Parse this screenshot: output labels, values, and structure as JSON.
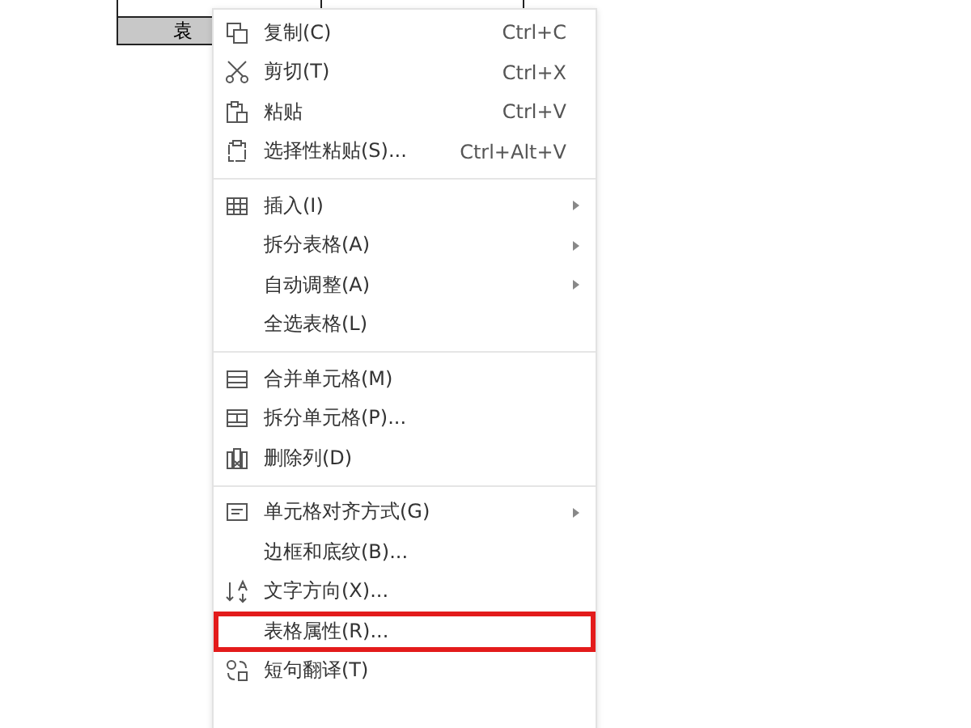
{
  "table": {
    "header_cells": [
      "",
      ""
    ],
    "cell": "袁"
  },
  "context_menu": {
    "groups": [
      [
        {
          "kind": "copy",
          "label": "复制(C)",
          "shortcut": "Ctrl+C",
          "has_submenu": false,
          "highlighted": false
        },
        {
          "kind": "cut",
          "label": "剪切(T)",
          "shortcut": "Ctrl+X",
          "has_submenu": false,
          "highlighted": false
        },
        {
          "kind": "paste",
          "label": "粘贴",
          "shortcut": "Ctrl+V",
          "has_submenu": false,
          "highlighted": false
        },
        {
          "kind": "paste_special",
          "label": "选择性粘贴(S)...",
          "shortcut": "Ctrl+Alt+V",
          "has_submenu": false,
          "highlighted": false
        }
      ],
      [
        {
          "kind": "insert",
          "label": "插入(I)",
          "has_submenu": true,
          "highlighted": false
        },
        {
          "kind": "plain",
          "label": "拆分表格(A)",
          "has_submenu": true,
          "highlighted": false
        },
        {
          "kind": "plain",
          "label": "自动调整(A)",
          "has_submenu": true,
          "highlighted": false
        },
        {
          "kind": "plain",
          "label": "全选表格(L)",
          "has_submenu": false,
          "highlighted": false
        }
      ],
      [
        {
          "kind": "merge",
          "label": "合并单元格(M)",
          "has_submenu": false,
          "highlighted": false
        },
        {
          "kind": "split",
          "label": "拆分单元格(P)...",
          "has_submenu": false,
          "highlighted": false
        },
        {
          "kind": "delete_column",
          "label": "删除列(D)",
          "has_submenu": false,
          "highlighted": false
        }
      ],
      [
        {
          "kind": "align",
          "label": "单元格对齐方式(G)",
          "has_submenu": true,
          "highlighted": false
        },
        {
          "kind": "plain",
          "label": "边框和底纹(B)...",
          "has_submenu": false,
          "highlighted": false
        },
        {
          "kind": "direction",
          "label": "文字方向(X)...",
          "has_submenu": false,
          "highlighted": false
        },
        {
          "kind": "plain",
          "label": "表格属性(R)...",
          "has_submenu": false,
          "highlighted": true
        },
        {
          "kind": "translate",
          "label": "短句翻译(T)",
          "has_submenu": false,
          "highlighted": false
        }
      ]
    ]
  }
}
